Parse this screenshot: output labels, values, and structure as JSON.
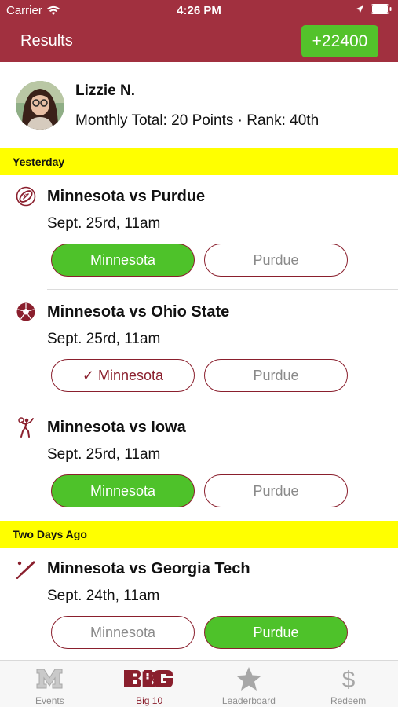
{
  "status_bar": {
    "carrier": "Carrier",
    "time": "4:26 PM"
  },
  "header": {
    "title": "Results",
    "points": "+22400"
  },
  "profile": {
    "name": "Lizzie N.",
    "stats": "Monthly Total: 20 Points · Rank: 40th"
  },
  "sections": [
    {
      "label": "Yesterday"
    },
    {
      "label": "Two Days Ago"
    }
  ],
  "events": [
    {
      "sport_icon": "football-icon",
      "matchup": "Minnesota vs Purdue",
      "datetime": "Sept. 25rd, 11am",
      "left_label": "Minnesota",
      "right_label": "Purdue",
      "selected": "left"
    },
    {
      "sport_icon": "soccer-ball-icon",
      "matchup": "Minnesota vs Ohio State",
      "datetime": "Sept. 25rd, 11am",
      "left_label": "✓ Minnesota",
      "right_label": "Purdue",
      "selected": "none-picked-left"
    },
    {
      "sport_icon": "volleyball-icon",
      "matchup": "Minnesota vs Iowa",
      "datetime": "Sept. 25rd, 11am",
      "left_label": "Minnesota",
      "right_label": "Purdue",
      "selected": "left"
    },
    {
      "sport_icon": "baseball-bat-icon",
      "matchup": "Minnesota vs Georgia Tech",
      "datetime": "Sept. 24th, 11am",
      "left_label": "Minnesota",
      "right_label": "Purdue",
      "selected": "right"
    }
  ],
  "tabs": [
    {
      "label": "Events",
      "icon": "minnesota-m-icon"
    },
    {
      "label": "Big 10",
      "icon": "big-ten-logo-icon",
      "active": true
    },
    {
      "label": "Leaderboard",
      "icon": "star-icon"
    },
    {
      "label": "Redeem",
      "icon": "dollar-icon"
    }
  ],
  "colors": {
    "maroon": "#a1303f",
    "green": "#4ec22a",
    "yellow": "#ffff00"
  }
}
